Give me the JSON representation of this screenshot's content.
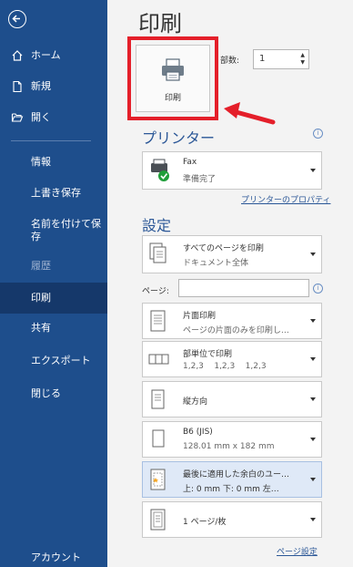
{
  "sidebar": {
    "nav": [
      {
        "label": "ホーム",
        "icon": "home-icon"
      },
      {
        "label": "新規",
        "icon": "new-document-icon"
      },
      {
        "label": "開く",
        "icon": "folder-open-icon"
      }
    ],
    "items": [
      {
        "label": "情報"
      },
      {
        "label": "上書き保存"
      },
      {
        "label": "名前を付けて保存"
      },
      {
        "label": "履歴"
      },
      {
        "label": "印刷"
      },
      {
        "label": "共有"
      },
      {
        "label": "エクスポート"
      },
      {
        "label": "閉じる"
      },
      {
        "label": "アカウント"
      }
    ]
  },
  "main": {
    "title": "印刷",
    "print_button": "印刷",
    "copies_label": "部数:",
    "copies_value": "1",
    "printer_section": "プリンター",
    "printer_name": "Fax",
    "printer_status": "準備完了",
    "printer_properties_link": "プリンターのプロパティ",
    "settings_section": "設定",
    "pages_label": "ページ:",
    "page_setup_link": "ページ設定",
    "settings": [
      {
        "line1": "すべてのページを印刷",
        "line2": "ドキュメント全体"
      },
      {
        "line1": "片面印刷",
        "line2": "ページの片面のみを印刷し…"
      },
      {
        "line1": "部単位で印刷",
        "line2": "1,2,3    1,2,3    1,2,3"
      },
      {
        "line1": "縦方向",
        "line2": ""
      },
      {
        "line1": "B6 (JIS)",
        "line2": "128.01 mm x 182 mm"
      },
      {
        "line1": "最後に適用した余白のユー…",
        "line2": "上: 0 mm 下: 0 mm 左…"
      },
      {
        "line1": "1 ページ/枚",
        "line2": ""
      }
    ]
  },
  "colors": {
    "sidebar_bg": "#1e4e8c",
    "sidebar_active": "#15386a",
    "accent": "#2b5797",
    "highlight_border": "#e41f2a"
  }
}
